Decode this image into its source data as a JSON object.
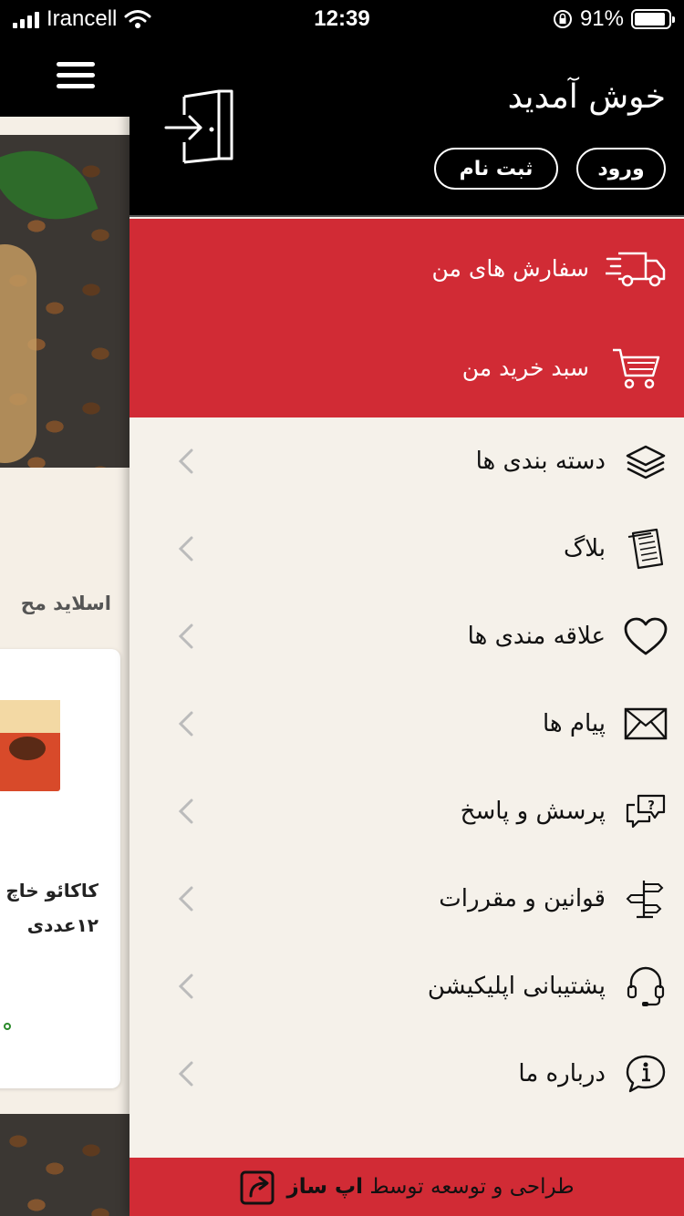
{
  "status_bar": {
    "carrier": "Irancell",
    "time": "12:39",
    "battery": "91%",
    "battery_level": 0.91
  },
  "background_app": {
    "section_title": "اسلاید مح",
    "product_title_line1": "کاکائو خاچ",
    "product_title_line2": "۱۲عددی"
  },
  "drawer": {
    "welcome": "خوش آمدید",
    "login_button": "ورود",
    "register_button": "ثبت نام",
    "highlight_items": [
      {
        "label": "سفارش های من",
        "icon": "delivery-truck-icon"
      },
      {
        "label": "سبد خرید من",
        "icon": "shopping-cart-icon"
      }
    ],
    "menu_items": [
      {
        "label": "دسته بندی ها",
        "icon": "layers-icon"
      },
      {
        "label": "بلاگ",
        "icon": "newspaper-icon"
      },
      {
        "label": "علاقه مندی ها",
        "icon": "heart-icon"
      },
      {
        "label": "پیام ها",
        "icon": "envelope-icon"
      },
      {
        "label": "پرسش و پاسخ",
        "icon": "question-chat-icon"
      },
      {
        "label": "قوانین و مقررات",
        "icon": "signpost-icon"
      },
      {
        "label": "پشتیبانی اپلیکیشن",
        "icon": "headset-icon"
      },
      {
        "label": "درباره ما",
        "icon": "info-icon"
      }
    ],
    "footer": {
      "text": "طراحی و توسعه توسط",
      "brand": "اپ ساز"
    }
  },
  "colors": {
    "accent_red": "#d12b35",
    "header_black": "#000000",
    "drawer_bg": "#f5f1ea"
  }
}
